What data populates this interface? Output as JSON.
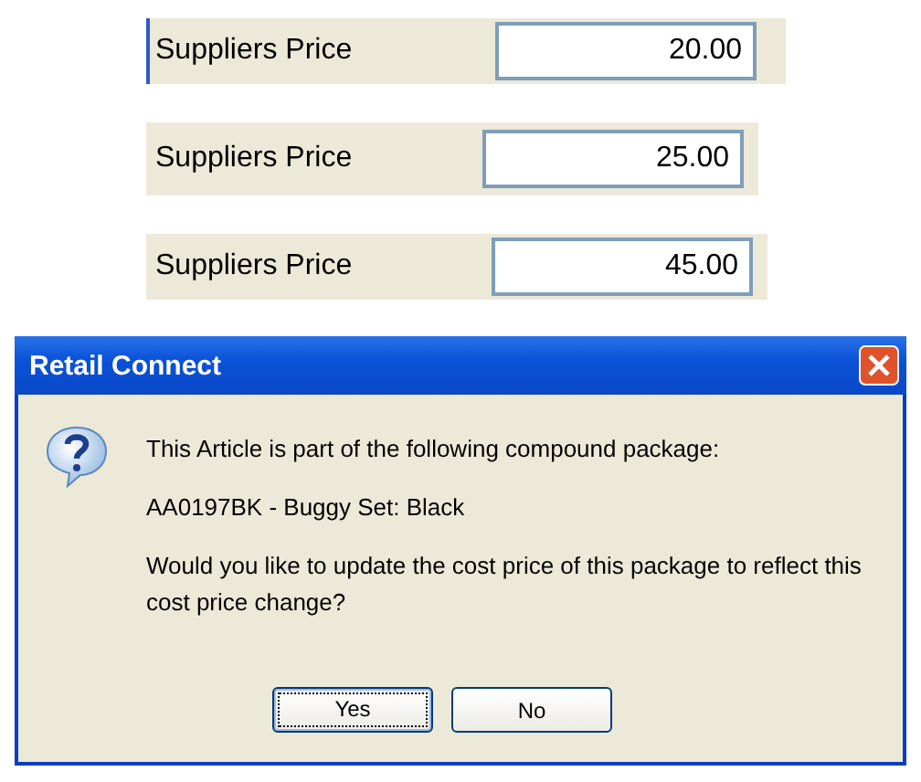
{
  "price_rows": [
    {
      "label": "Suppliers Price",
      "value": "20.00",
      "focused": true
    },
    {
      "label": "Suppliers Price",
      "value": "25.00",
      "focused": false
    },
    {
      "label": "Suppliers Price",
      "value": "45.00",
      "focused": false
    }
  ],
  "dialog": {
    "title": "Retail Connect",
    "message": [
      "This Article is part of the following compound package:",
      "AA0197BK - Buggy Set: Black",
      "Would you like to update the cost price of this package to reflect this cost price change?"
    ],
    "buttons": [
      {
        "label": "Yes",
        "default": true
      },
      {
        "label": "No",
        "default": false
      }
    ]
  }
}
